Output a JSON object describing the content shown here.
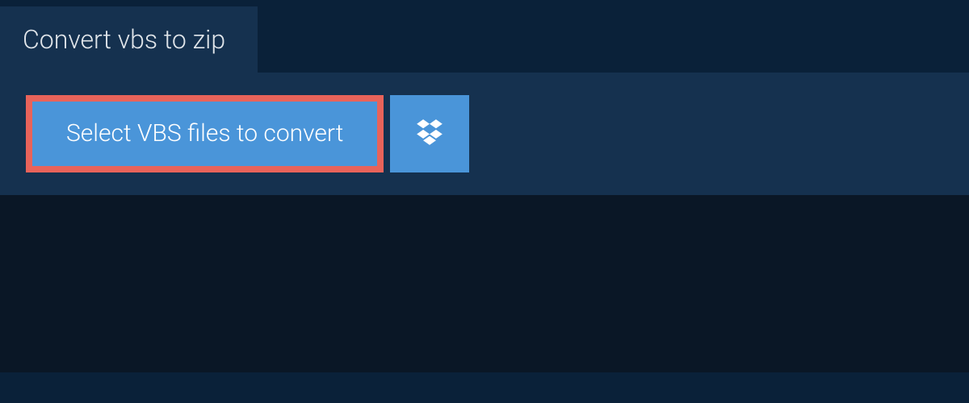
{
  "tab": {
    "title": "Convert vbs to zip"
  },
  "actions": {
    "select_label": "Select VBS files to convert"
  },
  "colors": {
    "background": "#0a2139",
    "panel": "#15314f",
    "button": "#4a95d9",
    "highlight_border": "#e8635a"
  }
}
